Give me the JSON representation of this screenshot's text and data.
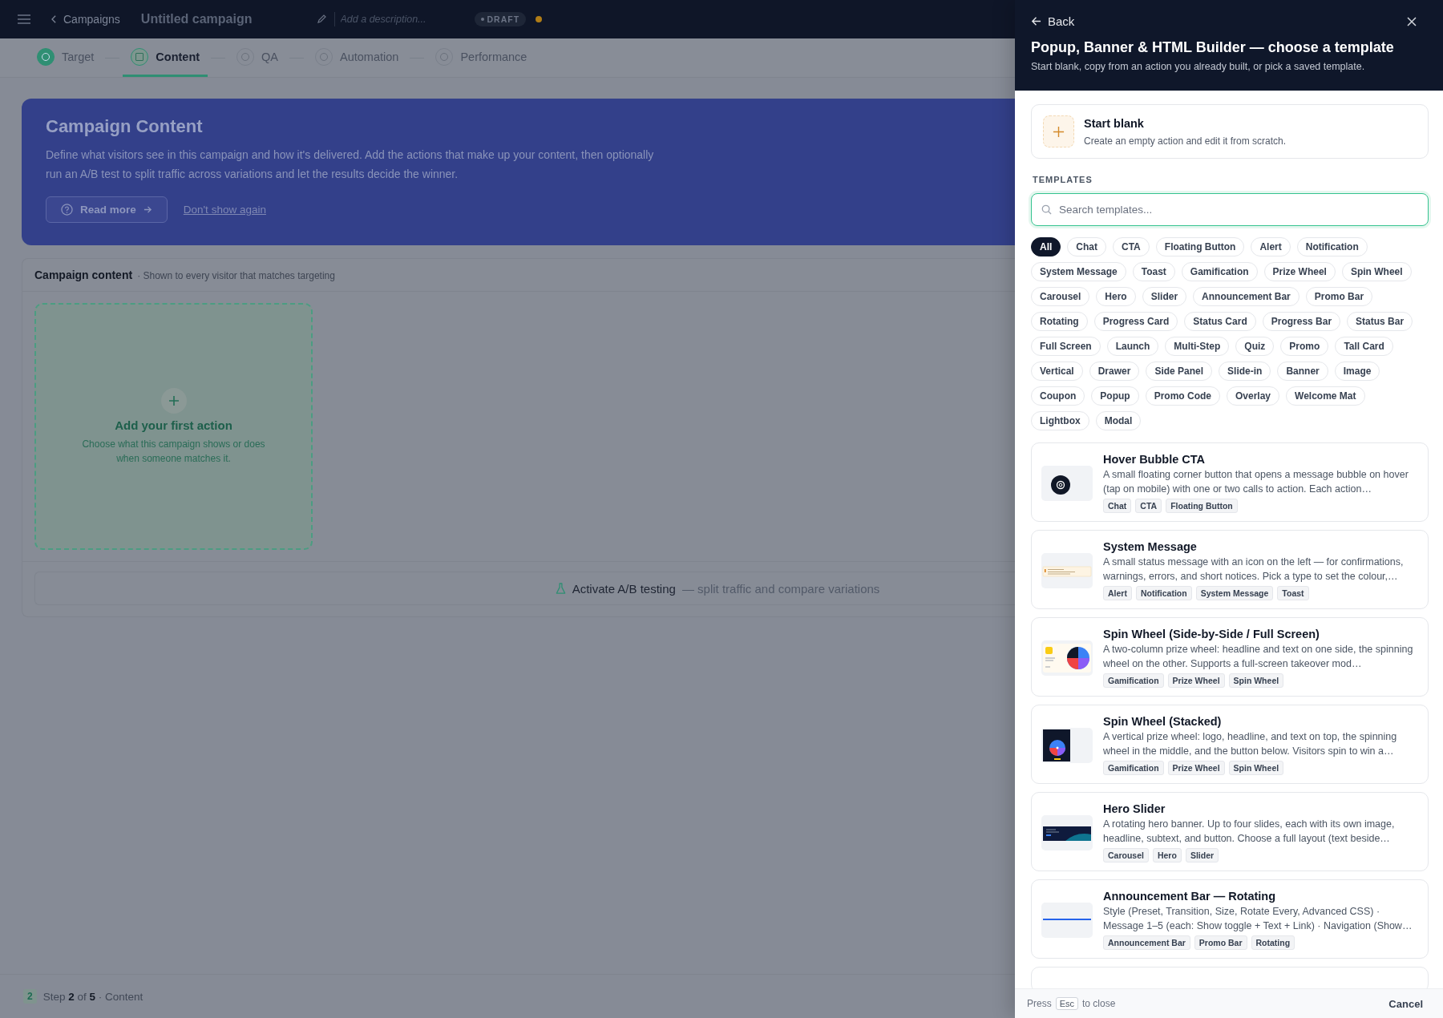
{
  "topbar": {
    "back_link": "Campaigns",
    "title": "Untitled campaign",
    "description_placeholder": "Add a description...",
    "status_badge": "DRAFT"
  },
  "steps": [
    {
      "label": "Target",
      "completed": true,
      "selected": false
    },
    {
      "label": "Content",
      "completed": false,
      "selected": true
    },
    {
      "label": "QA",
      "completed": false,
      "selected": false
    },
    {
      "label": "Automation",
      "completed": false,
      "selected": false
    },
    {
      "label": "Performance",
      "completed": false,
      "selected": false
    }
  ],
  "banner": {
    "title": "Campaign Content",
    "text": "Define what visitors see in this campaign and how it's delivered. Add the actions that make up your content, then optionally run an A/B test to split traffic across variations and let the results decide the winner.",
    "read_more": "Read more",
    "dismiss": "Don't show again"
  },
  "content_card": {
    "title": "Campaign content",
    "subtitle": "· Shown to every visitor that matches targeting",
    "add_title": "Add your first action",
    "add_text": "Choose what this campaign shows or does when someone matches it.",
    "ab_label": "Activate A/B testing",
    "ab_hint": "— split traffic and compare variations"
  },
  "footer": {
    "step_badge": "2",
    "step_text": "Step **2** of **5** · Content"
  },
  "drawer": {
    "back": "Back",
    "title": "Popup, Banner & HTML Builder — choose a template",
    "subtitle": "Start blank, copy from an action you already built, or pick a saved template.",
    "start_blank": {
      "title": "Start blank",
      "text": "Create an empty action and edit it from scratch."
    },
    "section_label": "TEMPLATES",
    "search_placeholder": "Search templates...",
    "filters": [
      {
        "label": "All",
        "selected": true
      },
      {
        "label": "Chat",
        "selected": false
      },
      {
        "label": "CTA",
        "selected": false
      },
      {
        "label": "Floating Button",
        "selected": false
      },
      {
        "label": "Alert",
        "selected": false
      },
      {
        "label": "Notification",
        "selected": false
      },
      {
        "label": "System Message",
        "selected": false
      },
      {
        "label": "Toast",
        "selected": false
      },
      {
        "label": "Gamification",
        "selected": false
      },
      {
        "label": "Prize Wheel",
        "selected": false
      },
      {
        "label": "Spin Wheel",
        "selected": false
      },
      {
        "label": "Carousel",
        "selected": false
      },
      {
        "label": "Hero",
        "selected": false
      },
      {
        "label": "Slider",
        "selected": false
      },
      {
        "label": "Announcement Bar",
        "selected": false
      },
      {
        "label": "Promo Bar",
        "selected": false
      },
      {
        "label": "Rotating",
        "selected": false
      },
      {
        "label": "Progress Card",
        "selected": false
      },
      {
        "label": "Status Card",
        "selected": false
      },
      {
        "label": "Progress Bar",
        "selected": false
      },
      {
        "label": "Status Bar",
        "selected": false
      },
      {
        "label": "Full Screen",
        "selected": false
      },
      {
        "label": "Launch",
        "selected": false
      },
      {
        "label": "Multi-Step",
        "selected": false
      },
      {
        "label": "Quiz",
        "selected": false
      },
      {
        "label": "Promo",
        "selected": false
      },
      {
        "label": "Tall Card",
        "selected": false
      },
      {
        "label": "Vertical",
        "selected": false
      },
      {
        "label": "Drawer",
        "selected": false
      },
      {
        "label": "Side Panel",
        "selected": false
      },
      {
        "label": "Slide-in",
        "selected": false
      },
      {
        "label": "Banner",
        "selected": false
      },
      {
        "label": "Image",
        "selected": false
      },
      {
        "label": "Coupon",
        "selected": false
      },
      {
        "label": "Popup",
        "selected": false
      },
      {
        "label": "Promo Code",
        "selected": false
      },
      {
        "label": "Overlay",
        "selected": false
      },
      {
        "label": "Welcome Mat",
        "selected": false
      },
      {
        "label": "Lightbox",
        "selected": false
      },
      {
        "label": "Modal",
        "selected": false
      }
    ],
    "templates": [
      {
        "kind": "bubble",
        "title": "Hover Bubble CTA",
        "text": "A small floating corner button that opens a message bubble on hover (tap on mobile) with one or two calls to action. Each action…",
        "tags": [
          "Chat",
          "CTA",
          "Floating Button"
        ]
      },
      {
        "kind": "message",
        "title": "System Message",
        "text": "A small status message with an icon on the left — for confirmations, warnings, errors, and short notices. Pick a type to set the colour,…",
        "tags": [
          "Alert",
          "Notification",
          "System Message",
          "Toast"
        ]
      },
      {
        "kind": "wheel-side",
        "title": "Spin Wheel (Side-by-Side / Full Screen)",
        "text": "A two-column prize wheel: headline and text on one side, the spinning wheel on the other. Supports a full-screen takeover mod…",
        "tags": [
          "Gamification",
          "Prize Wheel",
          "Spin Wheel"
        ]
      },
      {
        "kind": "wheel-stacked",
        "title": "Spin Wheel (Stacked)",
        "text": "A vertical prize wheel: logo, headline, and text on top, the spinning wheel in the middle, and the button below. Visitors spin to win a…",
        "tags": [
          "Gamification",
          "Prize Wheel",
          "Spin Wheel"
        ]
      },
      {
        "kind": "hero",
        "title": "Hero Slider",
        "text": "A rotating hero banner. Up to four slides, each with its own image, headline, subtext, and button. Choose a full layout (text beside…",
        "tags": [
          "Carousel",
          "Hero",
          "Slider"
        ]
      },
      {
        "kind": "bar",
        "title": "Announcement Bar — Rotating",
        "text": "Style (Preset, Transition, Size, Rotate Every, Advanced CSS) · Message 1–5 (each: Show toggle + Text + Link) · Navigation (Show…",
        "tags": [
          "Announcement Bar",
          "Promo Bar",
          "Rotating"
        ]
      }
    ],
    "footer": {
      "press": "Press",
      "key": "Esc",
      "to_close": "to close",
      "cancel": "Cancel"
    }
  }
}
